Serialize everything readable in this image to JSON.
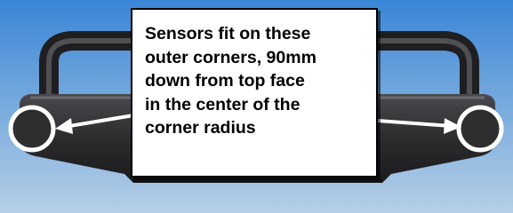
{
  "diagram": {
    "callout": {
      "lines": [
        "Sensors fit on these",
        "outer corners, 90mm",
        "down from top face",
        "in the center of the",
        "corner radius"
      ]
    },
    "colors": {
      "background_top": "#3a86d6",
      "background_bottom": "#b6cfe6",
      "bumper_dark": "#2a2a2c",
      "bumper_highlight": "#6e6e72",
      "marker_ring": "#ffffff",
      "arrow": "#ffffff",
      "callout_bg": "#ffffff",
      "callout_border": "#000000"
    },
    "markers": [
      {
        "name": "left-sensor-marker"
      },
      {
        "name": "right-sensor-marker"
      }
    ]
  }
}
